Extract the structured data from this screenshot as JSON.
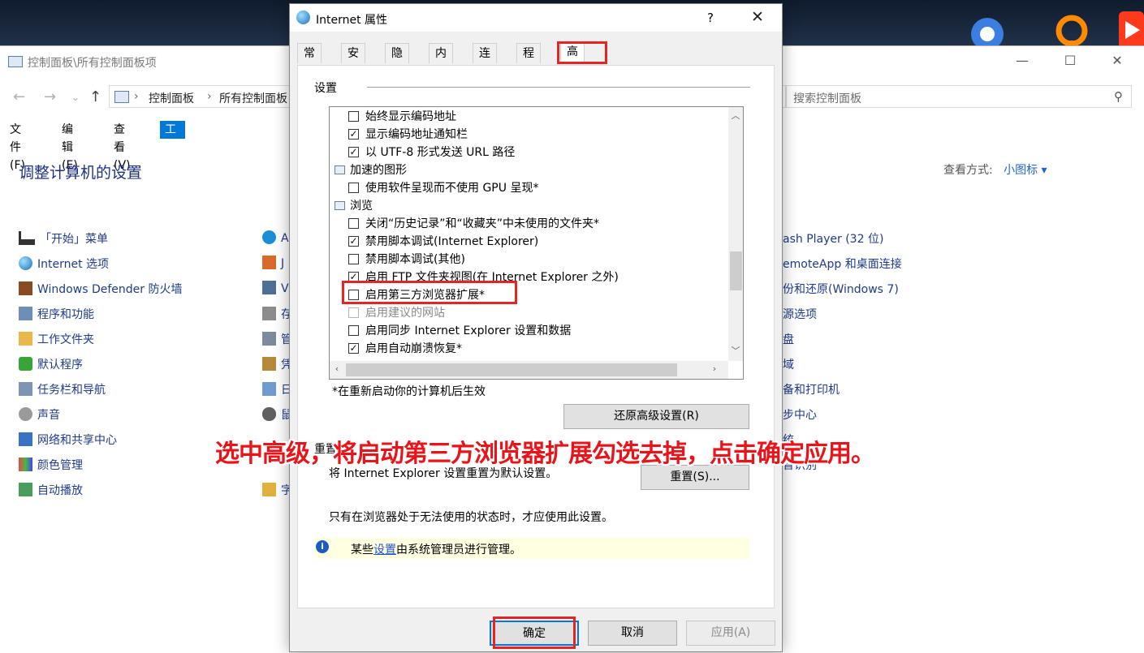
{
  "colors": {
    "accent": "#0078d7",
    "annotation": "#e52424",
    "link": "#1e3a8a",
    "info_bg": "#ffffe1"
  },
  "desktop": {
    "icons": [
      "app-icon",
      "app-icon",
      "media-player-icon"
    ]
  },
  "control_panel": {
    "title": "控制面板\\所有控制面板项",
    "breadcrumb": [
      "控制面板",
      "所有控制面板"
    ],
    "search_placeholder": "搜索控制面板",
    "menu": [
      "文件(F)",
      "编辑(E)",
      "查看(V)",
      "工具(T)"
    ],
    "heading": "调整计算机的设置",
    "view_by_label": "查看方式:",
    "view_by_value": "小图标 ▾",
    "items_col1": [
      "「开始」菜单",
      "Internet 选项",
      "Windows Defender 防火墙",
      "程序和功能",
      "工作文件夹",
      "默认程序",
      "任务栏和导航",
      "声音",
      "网络和共享中心",
      "颜色管理",
      "自动播放"
    ],
    "items_col2_partial": [
      "A",
      "J",
      "V",
      "存",
      "管",
      "凭",
      "日",
      "鼠",
      "",
      "",
      "字"
    ],
    "items_col3_partial": [
      "ash Player (32 位)",
      "emoteApp 和桌面连接",
      "份和还原(Windows 7)",
      "源选项",
      "盘",
      "域",
      "备和打印机",
      "步中心",
      "统",
      "音识别"
    ]
  },
  "dialog": {
    "title": "Internet 属性",
    "help": "?",
    "close": "✕",
    "tabs": [
      "常规",
      "安全",
      "隐私",
      "内容",
      "连接",
      "程序",
      "高级"
    ],
    "active_tab": "高级",
    "settings_label": "设置",
    "tree_rows": [
      {
        "type": "check",
        "checked": false,
        "label": "始终显示编码地址"
      },
      {
        "type": "check",
        "checked": true,
        "label": "显示编码地址通知栏"
      },
      {
        "type": "check",
        "checked": true,
        "label": "以 UTF-8 形式发送 URL 路径"
      },
      {
        "type": "group",
        "label": "加速的图形"
      },
      {
        "type": "check",
        "checked": false,
        "label": "使用软件呈现而不使用 GPU 呈现*"
      },
      {
        "type": "group",
        "label": "浏览"
      },
      {
        "type": "check",
        "checked": false,
        "label": "关闭“历史记录”和“收藏夹”中未使用的文件夹*"
      },
      {
        "type": "check",
        "checked": true,
        "label": "禁用脚本调试(Internet Explorer)"
      },
      {
        "type": "check",
        "checked": false,
        "label": "禁用脚本调试(其他)"
      },
      {
        "type": "check",
        "checked": true,
        "label": "启用 FTP 文件夹视图(在 Internet Explorer 之外)"
      },
      {
        "type": "check",
        "checked": false,
        "label": "启用第三方浏览器扩展*"
      },
      {
        "type": "check",
        "checked": false,
        "disabled": true,
        "label": "启用建议的网站"
      },
      {
        "type": "check",
        "checked": false,
        "label": "启用同步 Internet Explorer 设置和数据"
      },
      {
        "type": "check",
        "checked": true,
        "label": "启用自动崩溃恢复*"
      }
    ],
    "restart_note": "*在重新启动你的计算机后生效",
    "restore_button": "还原高级设置(R)",
    "reset_section_title": "重置",
    "reset_description": "将 Internet Explorer 设置重置为默认设置。",
    "reset_button": "重置(S)...",
    "usable_note": "只有在浏览器处于无法使用的状态时，才应使用此设置。",
    "info_prefix": "某些",
    "info_link": "设置",
    "info_suffix": "由系统管理员进行管理。",
    "ok_button": "确定",
    "cancel_button": "取消",
    "apply_button": "应用(A)"
  },
  "annotation": {
    "caption": "选中高级，将启动第三方浏览器扩展勾选去掉，点击确定应用。"
  }
}
